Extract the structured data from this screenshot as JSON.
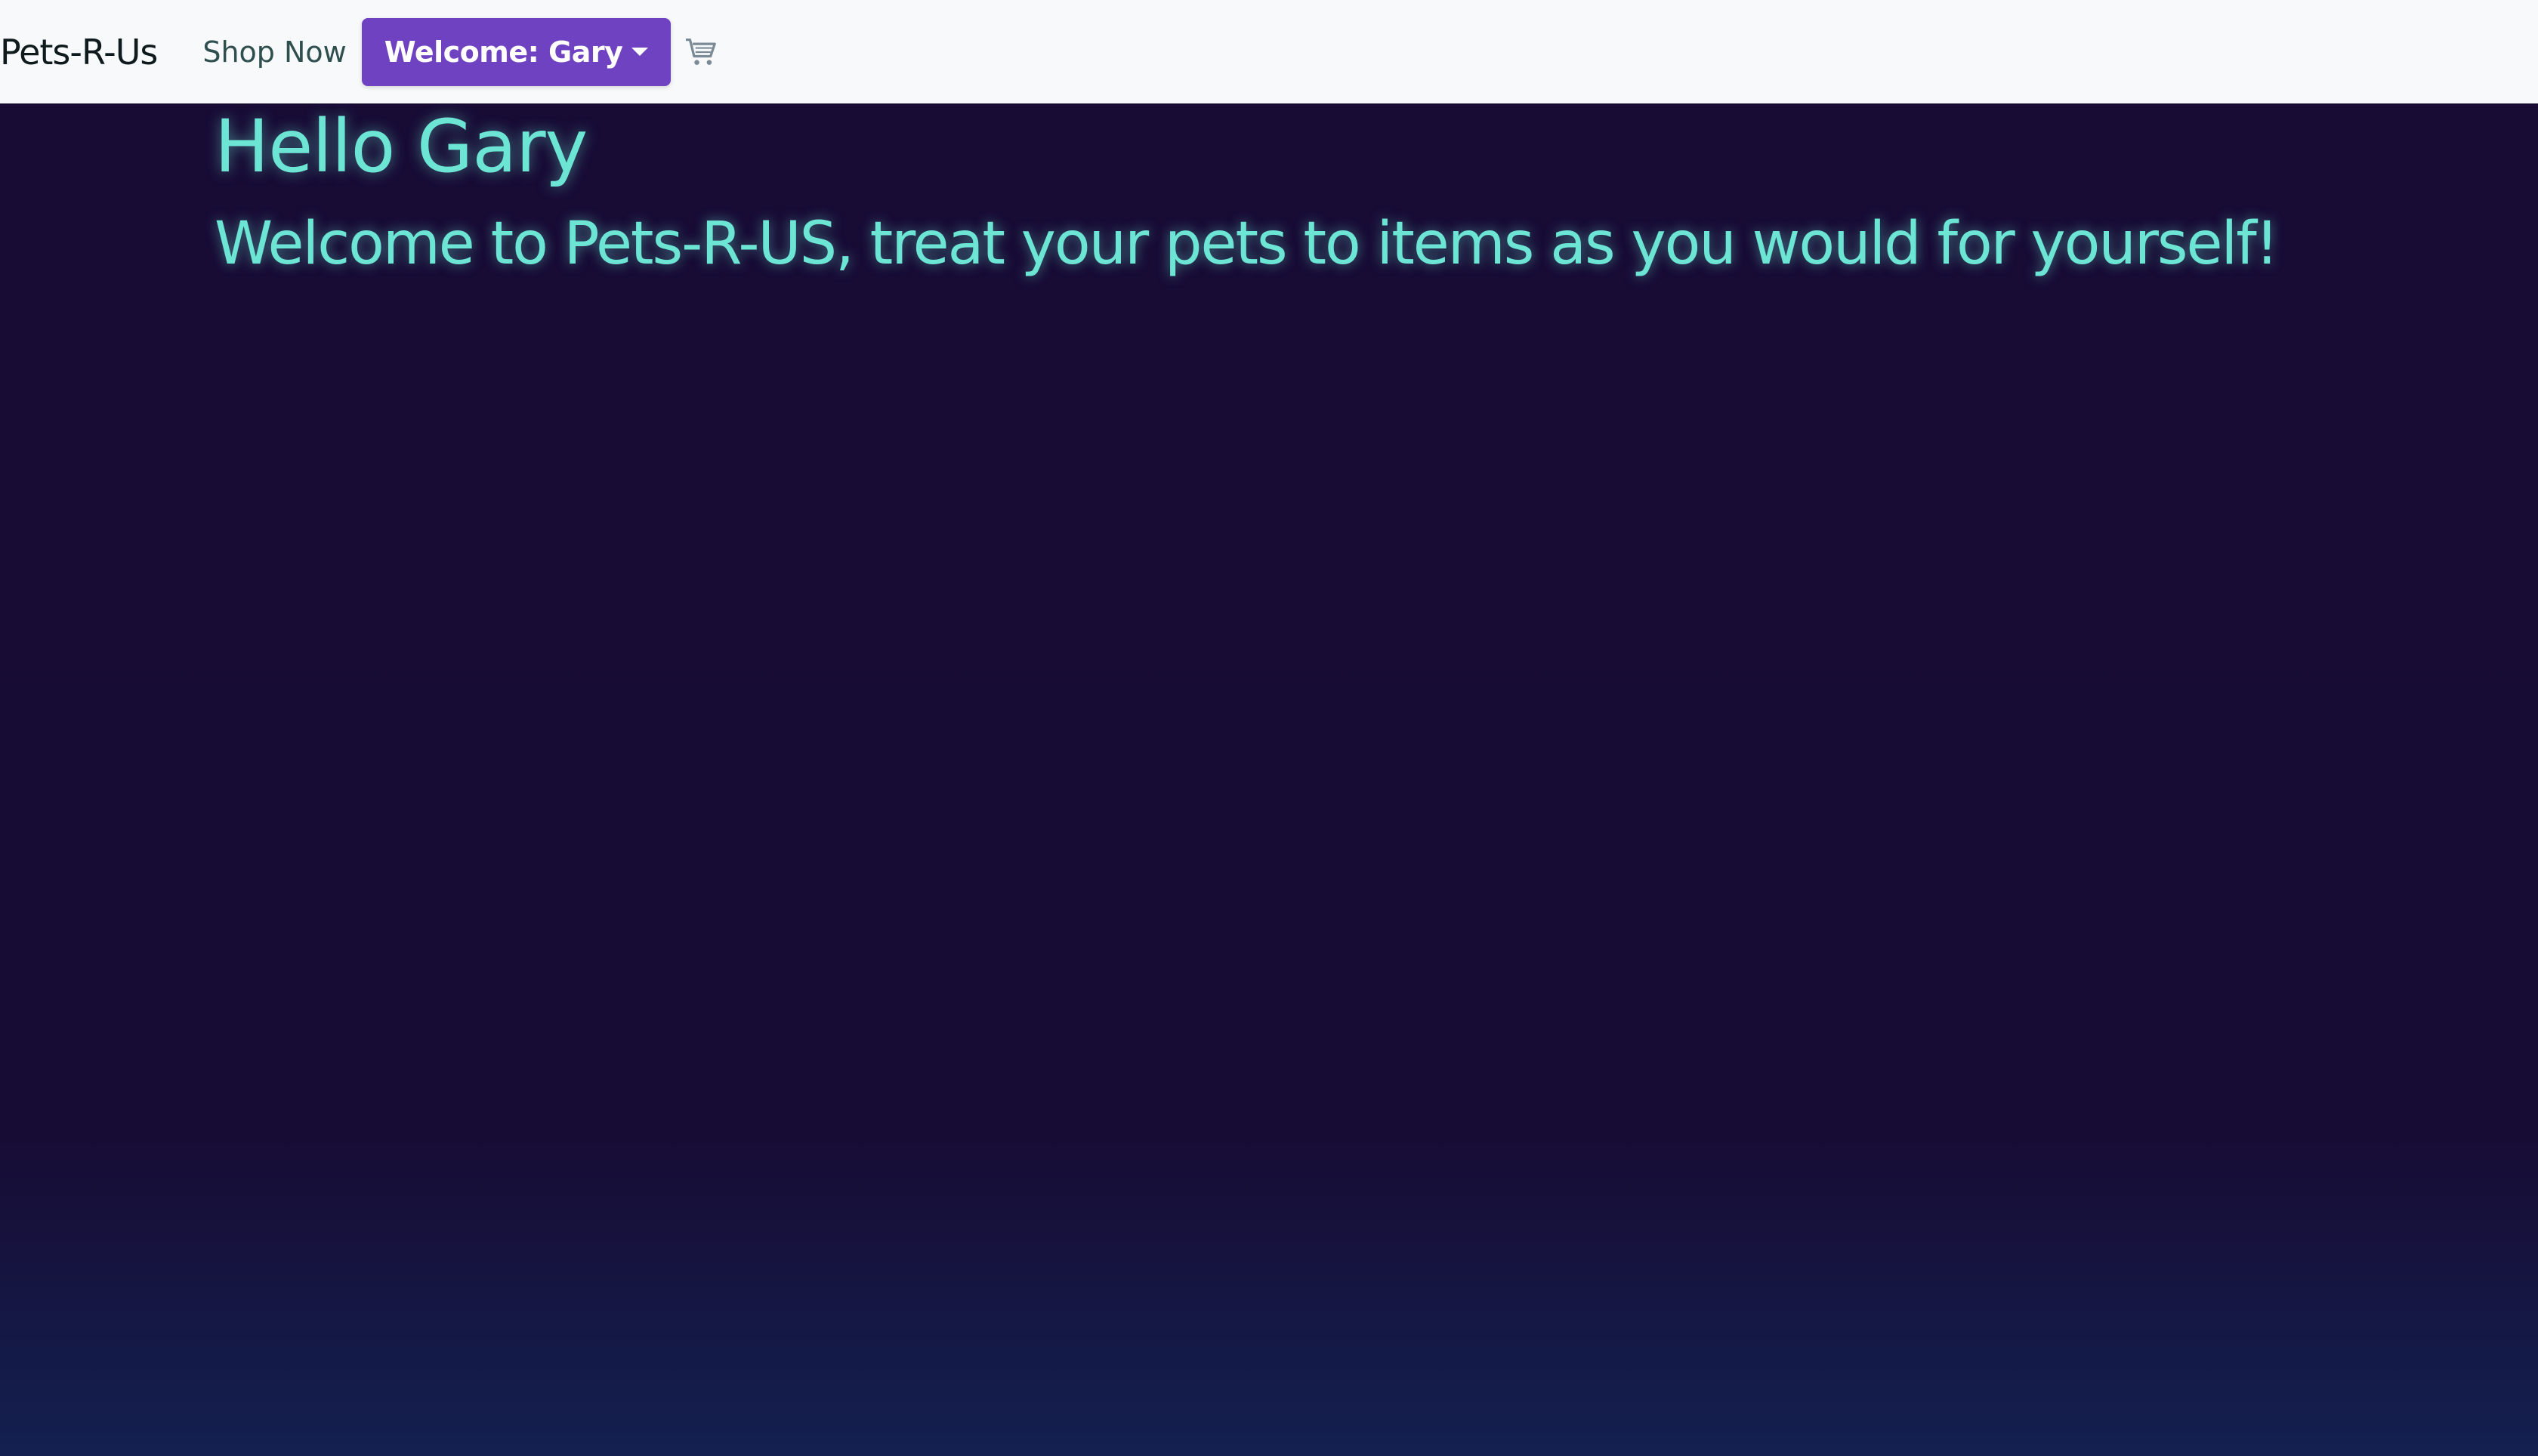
{
  "navbar": {
    "brand": "Pets-R-Us",
    "shop_link": "Shop Now",
    "user_dropdown": "Welcome: Gary",
    "cart_icon": "cart-icon"
  },
  "hero": {
    "greeting": "Hello Gary",
    "message": "Welcome to Pets-R-US, treat your pets to items as you would for yourself!"
  },
  "colors": {
    "background": "#170c34",
    "accent_text": "#6de5d4",
    "dropdown_button": "#6f42c1",
    "navbar": "#f8f9fa"
  }
}
